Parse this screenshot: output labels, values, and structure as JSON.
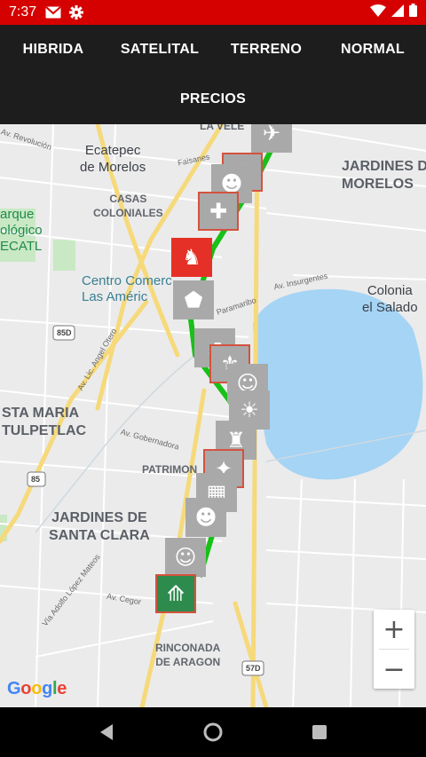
{
  "status": {
    "time": "7:37"
  },
  "toolbar": {
    "hibrida": "HIBRIDA",
    "satelital": "SATELITAL",
    "terreno": "TERRENO",
    "normal": "NORMAL",
    "precios": "PRECIOS"
  },
  "map": {
    "labels": {
      "la_velle": "LA VELE",
      "ecatepec": "Ecatepec\nde Morelos",
      "casas": "CASAS\nCOLONIALES",
      "jardines_morelos": "JARDINES D\nMORELOS",
      "parque": "arque\nológico\nECATL",
      "centro": "Centro Comerc\nLas Améric",
      "colonia": "Colonia\nel Salado",
      "santa_maria": "STA MARIA\nTULPETLAC",
      "patrimonio": "PATRIMON",
      "jardines_clara": "JARDINES DE\nSANTA CLARA",
      "rinconada": "RINCONADA\nDE ARAGON",
      "av_revolucion": "Av. Revolución",
      "faisanes": "Faisanes",
      "av_insurgentes": "Av. Insurgentes",
      "paramaribo": "Paramaribo",
      "av_angel": "Av. Lic. Angel Otero",
      "av_gobernadora": "Av. Gobernadora",
      "via_adolfo": "Vía Adolfo López Mateos",
      "av_cegor": "Av. Cegor",
      "shield_85d": "85D",
      "shield_85": "85",
      "shield_57d": "57D"
    },
    "zoom_in": "+",
    "zoom_out": "−",
    "google": "Google"
  },
  "colors": {
    "status": "#d50000",
    "appbar": "#1d1d1d",
    "route": "#18c018",
    "water": "#a5d4f5"
  }
}
